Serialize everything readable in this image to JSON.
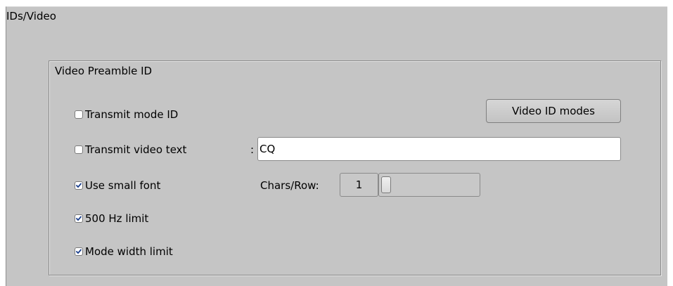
{
  "panel": {
    "title": "IDs/Video"
  },
  "group": {
    "title": "Video Preamble ID",
    "transmit_mode_id": {
      "label": "Transmit mode ID",
      "checked": false
    },
    "transmit_video_text": {
      "label": "Transmit video text",
      "checked": false,
      "separator": ":",
      "value": "CQ"
    },
    "use_small_font": {
      "label": "Use small font",
      "checked": true
    },
    "limit_500hz": {
      "label": "500 Hz limit",
      "checked": true
    },
    "mode_width_limit": {
      "label": "Mode width limit",
      "checked": true
    },
    "video_id_modes_button": "Video ID modes",
    "chars_per_row": {
      "label": "Chars/Row:",
      "value": "1"
    }
  },
  "colors": {
    "panel_bg": "#c5c5c5",
    "check_mark": "#1a3e8c"
  }
}
